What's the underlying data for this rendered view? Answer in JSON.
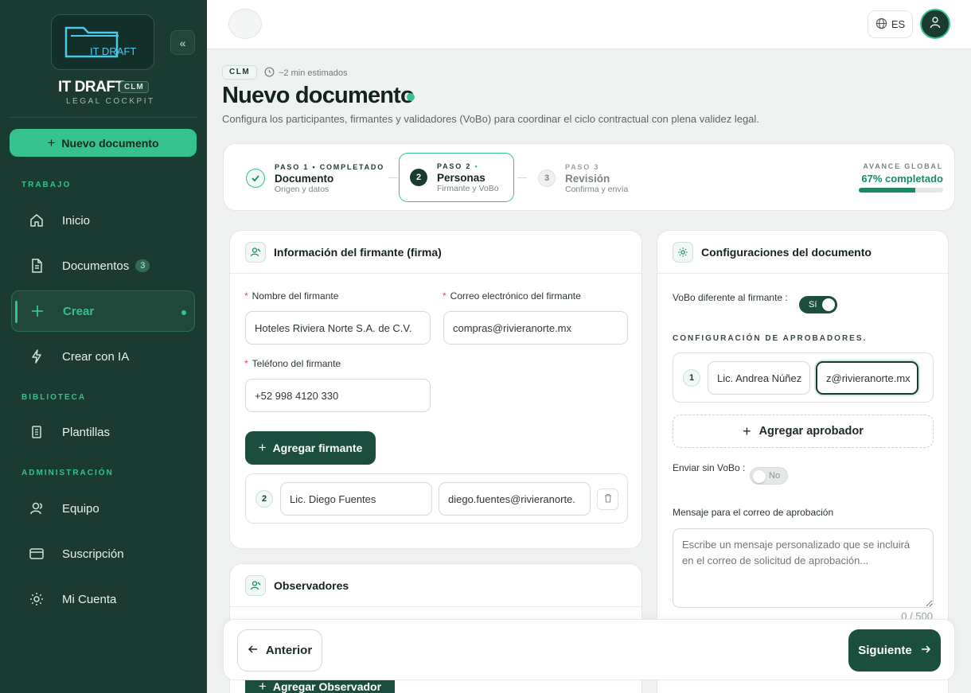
{
  "sidebar": {
    "logo_text": "IT DRAFT",
    "brand": "IT DRAFT",
    "brand_tag": "CLM",
    "brand_sub": "LEGAL COCKPIT",
    "new_doc_label": "Nuevo documento",
    "sections": {
      "trabajo": "TRABAJO",
      "biblioteca": "BIBLIOTECA",
      "admin": "ADMINISTRACIÓN"
    },
    "items": {
      "inicio": "Inicio",
      "documentos": "Documentos",
      "documentos_badge": "3",
      "crear": "Crear",
      "crear_ia": "Crear con IA",
      "plantillas": "Plantillas",
      "equipo": "Equipo",
      "suscripcion": "Suscripción",
      "mi_cuenta": "Mi Cuenta"
    }
  },
  "topbar": {
    "lang": "ES"
  },
  "header": {
    "tag": "CLM",
    "estimate": "~2 min estimados",
    "title": "Nuevo documento",
    "subtitle": "Configura los participantes, firmantes y validadores (VoBo) para coordinar el ciclo contractual con plena validez legal."
  },
  "stepper": {
    "steps": [
      {
        "kicker": "PASO 1 • COMPLETADO",
        "title": "Documento",
        "desc": "Origen y datos",
        "num": "1",
        "state": "done"
      },
      {
        "kicker": "PASO 2",
        "title": "Personas",
        "desc": "Firmante y VoBo",
        "num": "2",
        "state": "current"
      },
      {
        "kicker": "PASO 3",
        "title": "Revisión",
        "desc": "Confirma y envía",
        "num": "3",
        "state": "pending"
      }
    ],
    "avance_label": "AVANCE GLOBAL",
    "avance_value": "67% completado",
    "progress": 0.67
  },
  "signer": {
    "title": "Información del firmante (firma)",
    "name_label": "Nombre del firmante",
    "name_value": "Hoteles Riviera Norte S.A. de C.V.",
    "email_label": "Correo electrónico del firmante",
    "email_value": "compras@rivieranorte.mx",
    "phone_label": "Teléfono del firmante",
    "phone_value": "+52 998 4120 330",
    "add_label": "Agregar firmante",
    "extra_num": "2",
    "extra_name": "Lic. Diego Fuentes",
    "extra_email": "diego.fuentes@rivieranorte."
  },
  "observers": {
    "title": "Observadores",
    "add_label": "Agregar Observador"
  },
  "config": {
    "title": "Configuraciones del documento",
    "vobo_label": "VoBo diferente al firmante :",
    "vobo_toggle": "Sí",
    "vobo_on": true,
    "approvers_label": "CONFIGURACIÓN DE APROBADORES.",
    "approver_num": "1",
    "approver_name": "Lic. Andrea Núñez",
    "approver_email": "z@rivieranorte.mx",
    "add_approver": "Agregar aprobador",
    "send_label": "Enviar sin VoBo :",
    "send_toggle": "No",
    "send_on": false,
    "message_label": "Mensaje para el correo de aprobación",
    "message_placeholder": "Escribe un mensaje personalizado que se incluirá en el correo de solicitud de aprobación...",
    "counter": "0 / 500"
  },
  "footer": {
    "prev": "Anterior",
    "next": "Siguiente"
  },
  "colors": {
    "sidebar": "#1b3a31",
    "accent": "#35c28f",
    "primary": "#1b4e3f"
  }
}
